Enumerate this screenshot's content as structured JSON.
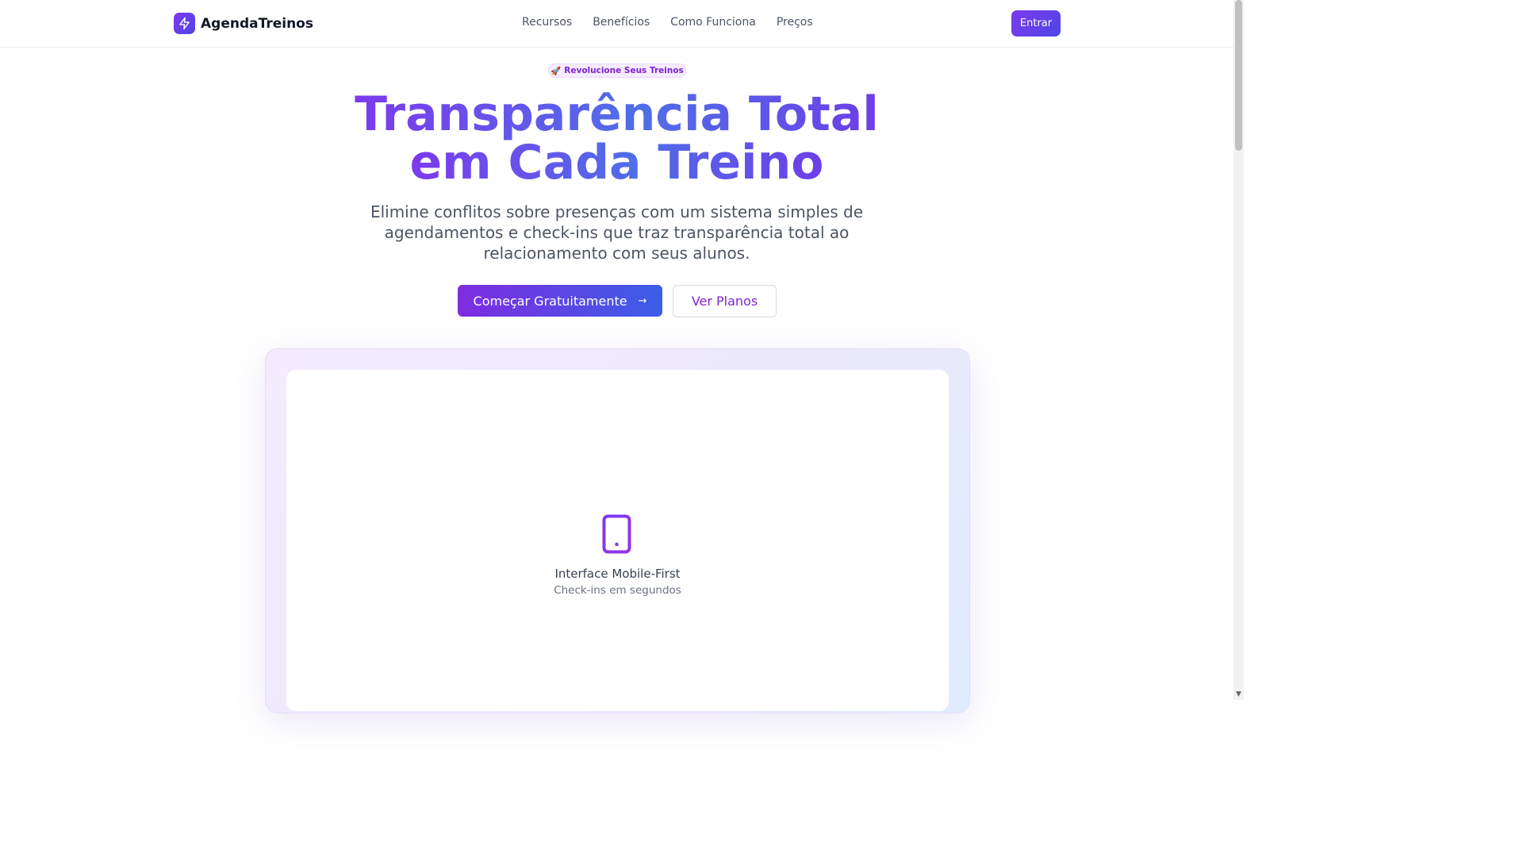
{
  "header": {
    "brand": "AgendaTreinos",
    "nav": [
      "Recursos",
      "Benefícios",
      "Como Funciona",
      "Preços"
    ],
    "login_label": "Entrar"
  },
  "hero": {
    "badge_emoji": "🚀",
    "badge_text": "Revolucione Seus Treinos",
    "title_line1": "Transparência Total",
    "title_line2": "em Cada Treino",
    "subtitle": "Elimine conflitos sobre presenças com um sistema simples de agendamentos e check-ins que traz transparência total ao relacionamento com seus alunos.",
    "cta_primary": "Começar Gratuitamente",
    "cta_arrow": "→",
    "cta_secondary": "Ver Planos"
  },
  "showcase": {
    "icon": "smartphone-icon",
    "title": "Interface Mobile-First",
    "subtitle": "Check-ins em segundos"
  },
  "colors": {
    "brand_purple": "#7c3aed",
    "brand_blue": "#4f46e5",
    "text_muted": "#4b5563"
  }
}
